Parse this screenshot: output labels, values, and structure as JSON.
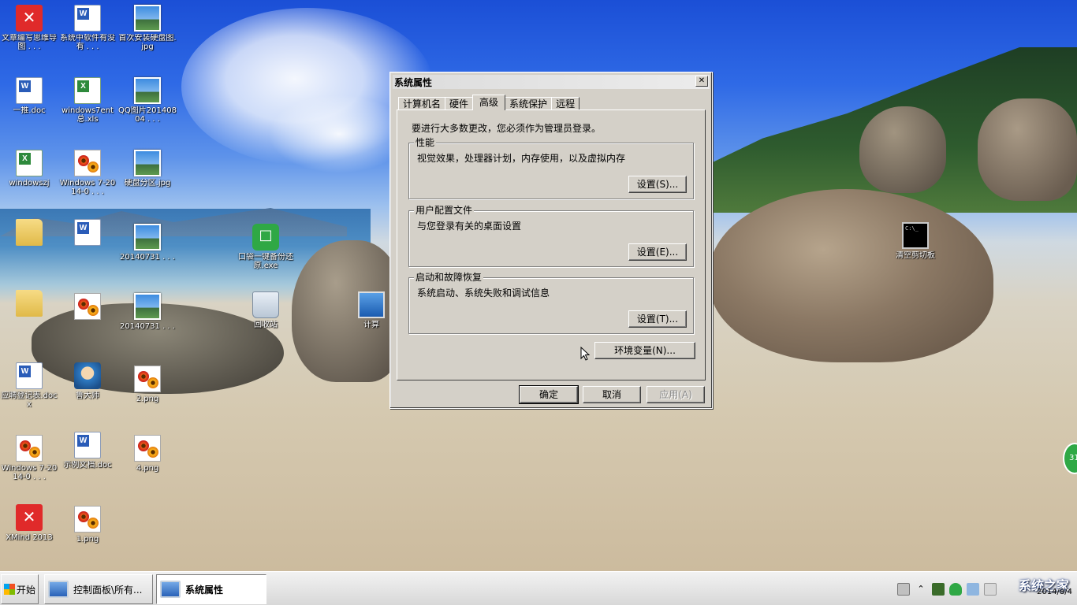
{
  "desktop": {
    "icons": [
      {
        "label": "文章编写思维导图 . . .",
        "icon": "xmind-icon"
      },
      {
        "label": "系统中软件有没有 . . .",
        "icon": "word-doc-icon"
      },
      {
        "label": "首次安装硬盘图.jpg",
        "icon": "image-icon"
      },
      {
        "label": "一推.doc",
        "icon": "word-doc-icon"
      },
      {
        "label": "windows7ent总.xls",
        "icon": "excel-icon"
      },
      {
        "label": "QQ图片20140804 . . .",
        "icon": "image-icon"
      },
      {
        "label": "windowszj",
        "icon": "excel-icon"
      },
      {
        "label": "Windows 7-2014-0 . . .",
        "icon": "flower-image-icon"
      },
      {
        "label": "硬盘分区.jpg",
        "icon": "image-icon"
      },
      {
        "label": "",
        "icon": "folder-icon"
      },
      {
        "label": "",
        "icon": "word-doc-icon"
      },
      {
        "label": "20140731 . . .",
        "icon": "image-icon"
      },
      {
        "label": "口袋一键备份还原.exe",
        "icon": "green-app-icon"
      },
      {
        "label": "",
        "icon": "folder-icon"
      },
      {
        "label": "",
        "icon": "flower-image-icon"
      },
      {
        "label": "20140731 . . .",
        "icon": "image-icon"
      },
      {
        "label": "回收站",
        "icon": "recycle-bin-icon"
      },
      {
        "label": "计算",
        "icon": "computer-icon"
      },
      {
        "label": "应聘登记表.docx",
        "icon": "word-doc-icon"
      },
      {
        "label": "鲁大师",
        "icon": "ludashi-icon"
      },
      {
        "label": "2.png",
        "icon": "flower-image-icon"
      },
      {
        "label": "Windows 7-2014-0 . . .",
        "icon": "flower-image-icon"
      },
      {
        "label": "示例文档.doc",
        "icon": "word-doc-icon"
      },
      {
        "label": "4.png",
        "icon": "flower-image-icon"
      },
      {
        "label": "XMind 2013",
        "icon": "xmind-icon"
      },
      {
        "label": "1.png",
        "icon": "flower-image-icon"
      },
      {
        "label": "清空剪切板",
        "icon": "cmd-icon"
      }
    ]
  },
  "dialog": {
    "title": "系统属性",
    "close_label": "✕",
    "tabs": [
      {
        "label": "计算机名"
      },
      {
        "label": "硬件"
      },
      {
        "label": "高级"
      },
      {
        "label": "系统保护"
      },
      {
        "label": "远程"
      }
    ],
    "active_tab": "高级",
    "notice": "要进行大多数更改，您必须作为管理员登录。",
    "performance": {
      "title": "性能",
      "description": "视觉效果，处理器计划，内存使用，以及虚拟内存",
      "button": "设置(S)..."
    },
    "user_profile": {
      "title": "用户配置文件",
      "description": "与您登录有关的桌面设置",
      "button": "设置(E)..."
    },
    "startup_recovery": {
      "title": "启动和故障恢复",
      "description": "系统启动、系统失败和调试信息",
      "button": "设置(T)..."
    },
    "env_button": "环境变量(N)...",
    "ok_button": "确定",
    "cancel_button": "取消",
    "apply_button": "应用(A)"
  },
  "taskbar": {
    "start_label": "开始",
    "tasks": [
      {
        "label": "控制面板\\所有..."
      },
      {
        "label": "系统属性"
      }
    ],
    "clock_date": "2014/8/4",
    "watermark": "系统之家",
    "side_badge": "31"
  }
}
